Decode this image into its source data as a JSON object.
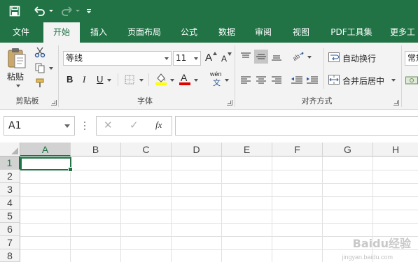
{
  "quick_access": {
    "save": "save-icon",
    "undo": "undo-icon",
    "redo": "redo-icon",
    "customize": "customize-qat-icon"
  },
  "tabs": [
    "文件",
    "开始",
    "插入",
    "页面布局",
    "公式",
    "数据",
    "审阅",
    "视图",
    "PDF工具集",
    "更多工"
  ],
  "active_tab": "开始",
  "ribbon": {
    "clipboard": {
      "paste_label": "粘贴",
      "group_label": "剪贴板"
    },
    "font": {
      "font_name": "等线",
      "font_size": "11",
      "bold": "B",
      "italic": "I",
      "underline": "U",
      "grow": "A",
      "shrink": "A",
      "pinyin_top": "wén",
      "pinyin_bottom": "文",
      "font_color_letter": "A",
      "group_label": "字体",
      "fill_color": "#ffff00",
      "font_color": "#e00000"
    },
    "alignment": {
      "wrap_text": "自动换行",
      "merge_center": "合并后居中",
      "group_label": "对齐方式"
    },
    "number": {
      "format_partial": "常规"
    }
  },
  "formula_bar": {
    "name_box": "A1",
    "cancel": "✕",
    "enter": "✓",
    "fx": "fx",
    "value": ""
  },
  "grid": {
    "columns": [
      "A",
      "B",
      "C",
      "D",
      "E",
      "F",
      "G",
      "H"
    ],
    "rows": [
      "1",
      "2",
      "3",
      "4",
      "5",
      "6",
      "7",
      "8"
    ],
    "active_cell": "A1"
  },
  "watermark": {
    "text": "Baidu经验",
    "url": "jingyan.baidu.com"
  },
  "colors": {
    "brand": "#217346",
    "ribbon_bg": "#f3f3f3"
  }
}
